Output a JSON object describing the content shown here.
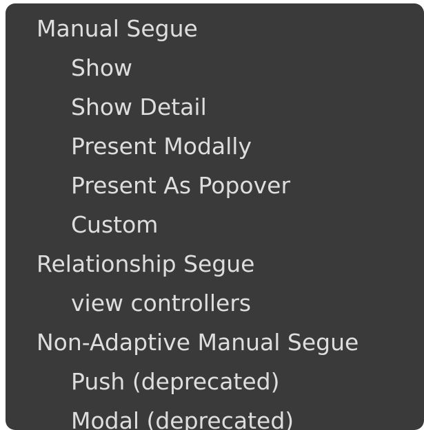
{
  "menu": {
    "sections": [
      {
        "header": "Manual Segue",
        "items": [
          "Show",
          "Show Detail",
          "Present Modally",
          "Present As Popover",
          "Custom"
        ]
      },
      {
        "header": "Relationship Segue",
        "items": [
          "view controllers"
        ]
      },
      {
        "header": "Non-Adaptive Manual Segue",
        "items": [
          "Push (deprecated)",
          "Modal (deprecated)"
        ]
      }
    ]
  }
}
